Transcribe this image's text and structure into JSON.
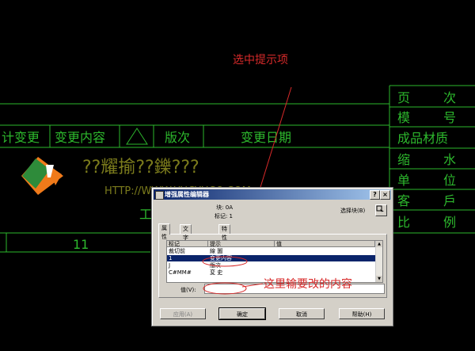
{
  "drawing": {
    "title_block_left": [
      "计变更",
      "变更内容",
      "版次",
      "变更日期"
    ],
    "title_block_right": [
      {
        "a": "页",
        "b": "次"
      },
      {
        "a": "模",
        "b": "号"
      },
      {
        "a": "成品材质",
        "b": ""
      },
      {
        "a": "缩",
        "b": "水"
      },
      {
        "a": "单",
        "b": "位"
      },
      {
        "a": "客",
        "b": "戶"
      },
      {
        "a": "比",
        "b": "例"
      }
    ],
    "company_name": "??耀揄??鑠???",
    "company_url": "HTTP://WWW.YUCYUCO.COM",
    "company_partial": "工",
    "row_number": "11"
  },
  "annotations": {
    "select_hint": "选中提示项",
    "edit_hint": "这里输要改的内容"
  },
  "dialog": {
    "title": "增强属性编辑器",
    "block_label": "块: 0A",
    "tag_label": "标记: 1",
    "select_block": "选择块(B)",
    "tabs": [
      "属性",
      "文字选项",
      "特性"
    ],
    "columns": [
      "标记",
      "提示",
      "值"
    ],
    "rows": [
      {
        "tag": "裁切前",
        "prompt": "線 圖",
        "value": ""
      },
      {
        "tag": "1",
        "prompt": "变更内容",
        "value": ""
      },
      {
        "tag": "J",
        "prompt": "版次",
        "value": ""
      },
      {
        "tag": "C#MM#",
        "prompt": "変 史",
        "value": ""
      }
    ],
    "value_label": "值(V):",
    "value_text": "",
    "buttons": {
      "apply": "应用(A)",
      "ok": "确定",
      "cancel": "取消",
      "help": "帮助(H)"
    }
  },
  "colors": {
    "line": "#2db82d",
    "annotation": "#d82a2a",
    "selection": "#0a246a"
  }
}
